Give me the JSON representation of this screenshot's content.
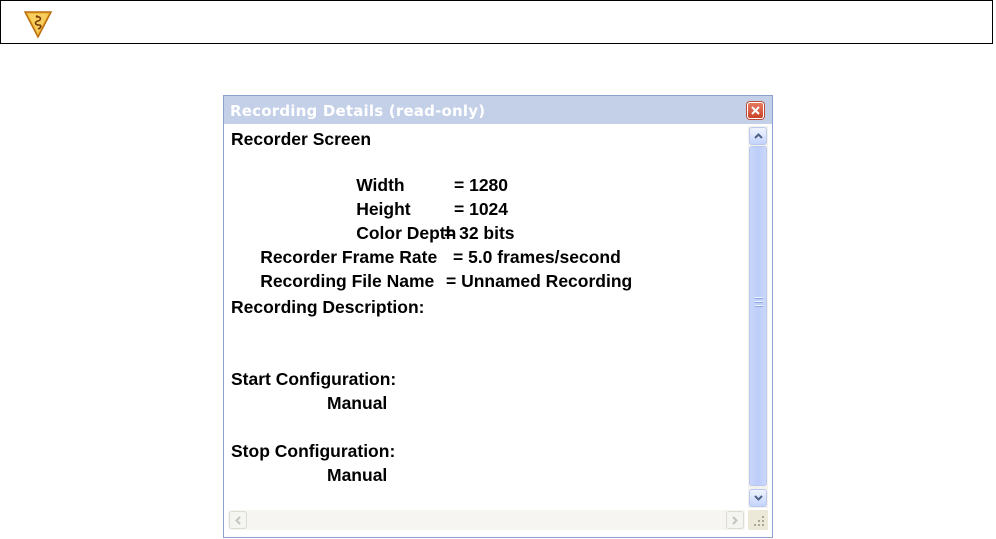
{
  "toolbar": {
    "logo_icon": "app-logo-icon"
  },
  "dialog": {
    "title": "Recording Details (read-only)",
    "close_icon": "close-icon",
    "lines": [
      {
        "label": "Recorder Screen",
        "value": ""
      },
      {
        "label": "Width",
        "value": "= 1280"
      },
      {
        "label": "Height",
        "value": "= 1024"
      },
      {
        "label": "Color Depth",
        "value": "= 32 bits"
      },
      {
        "label": "Recorder Frame Rate",
        "value": "= 5.0 frames/second"
      },
      {
        "label": "Recording File Name",
        "value": "= Unnamed Recording"
      },
      {
        "label": "Recording Description:",
        "value": ""
      },
      {
        "label": "Start Configuration:",
        "value": ""
      },
      {
        "label": "Manual",
        "value": ""
      },
      {
        "label": "Stop Configuration:",
        "value": ""
      },
      {
        "label": "Manual",
        "value": ""
      }
    ]
  },
  "colors": {
    "title_bar": "#c4cfe8",
    "close_button": "#d0573c",
    "scrollbar": "#c3d3fd"
  }
}
